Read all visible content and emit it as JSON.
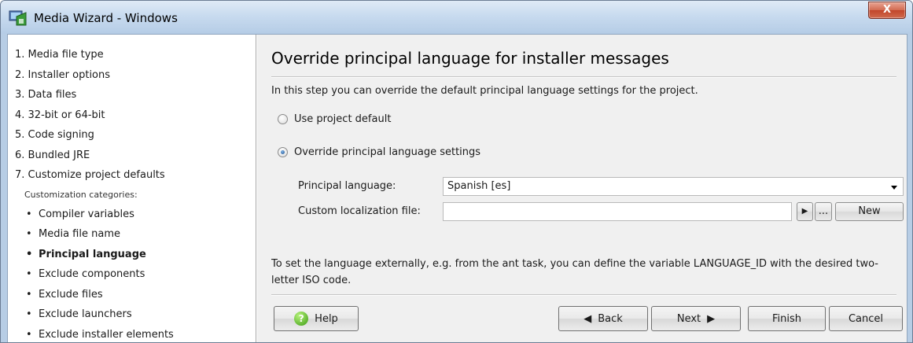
{
  "window": {
    "title": "Media Wizard - Windows",
    "close_label": "X"
  },
  "sidebar": {
    "steps": [
      "1. Media file type",
      "2. Installer options",
      "3. Data files",
      "4. 32-bit or 64-bit",
      "5. Code signing",
      "6. Bundled JRE",
      "7. Customize project defaults"
    ],
    "category_label": "Customization categories:",
    "sub_items": [
      "Compiler variables",
      "Media file name",
      "Principal language",
      "Exclude components",
      "Exclude files",
      "Exclude launchers",
      "Exclude installer elements"
    ],
    "bullet": "•"
  },
  "main": {
    "heading": "Override principal language for installer messages",
    "intro": "In this step you can override the default principal language settings for the project.",
    "radio_default": "Use project default",
    "radio_override": "Override principal language settings",
    "principal_language_label": "Principal language:",
    "principal_language_value": "Spanish [es]",
    "custom_file_label": "Custom localization file:",
    "custom_file_value": "",
    "play_label": "▶",
    "browse_label": "...",
    "new_label": "New",
    "note": "To set the language externally, e.g. from the ant task, you can define the variable LANGUAGE_ID with the desired two-letter ISO code."
  },
  "footer": {
    "help": "Help",
    "back": "Back",
    "next": "Next",
    "finish": "Finish",
    "cancel": "Cancel",
    "back_arrow": "◀",
    "next_arrow": "▶"
  },
  "selected_radio": "override",
  "icons": {
    "app": "media-wizard-app-icon",
    "help": "help-icon",
    "close": "close-icon",
    "dropdown": "chevron-down-icon"
  }
}
